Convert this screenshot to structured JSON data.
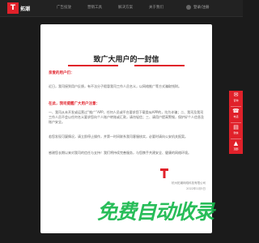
{
  "brand": {
    "mark": "T",
    "name": "拓潮",
    "sub": "Tuochao"
  },
  "nav": [
    {
      "label": "广告投放"
    },
    {
      "label": "营销工具"
    },
    {
      "label": "解决方案"
    },
    {
      "label": "关于我们"
    }
  ],
  "user": {
    "label": "登录/注册"
  },
  "letter": {
    "title": "致广大用户的一封信",
    "greeting": "亲爱的用户们：",
    "p1": "近日，我司接到用户反馈，有不法分子假冒我司工作人员名义，以网络推广等方式骗取钱财。",
    "subhead": "在此，我司提醒广大用户注意：",
    "p2": "一、我司从未开发或运营过“推广”APP，任何人员或平台要求您下载类似APP的，均为诈骗；二、我司及我司工作人员不会以任何名义要求您向个人账户转账或汇款，请勿轻信；三、请用户提高警惕，保护好个人信息及账户安全。",
    "p3": "若您发现可疑情况，请立即停止操作，并第一时间联系我司客服核实，必要时请向公安机关报案。",
    "p4": "感谢您长期以来对我司的信任与支持！我们将持续完善服务，与您携手共建安全、健康的网络环境。",
    "org": "杭州拓潮网络科技有限公司",
    "date": "2022年1月5日"
  },
  "banner": "免费自动收录",
  "sidebar": [
    {
      "glyph": "✉",
      "label": "咨询"
    },
    {
      "glyph": "☎",
      "label": "电话"
    },
    {
      "glyph": "▤",
      "label": "微信"
    },
    {
      "glyph": "▲",
      "label": "顶部"
    }
  ],
  "colors": {
    "brand": "#e0212a",
    "green": "#16b84c"
  }
}
